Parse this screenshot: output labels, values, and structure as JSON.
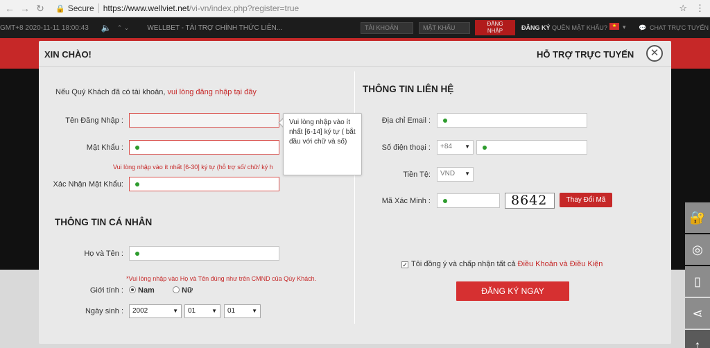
{
  "browser": {
    "secure_label": "Secure",
    "url_host": "https://www.wellviet.net",
    "url_path": "/vi-vn/index.php?register=true"
  },
  "site_header": {
    "timestamp": "GMT+8 2020-11-11 18:00:43",
    "marquee": "WELLBET - TÀI TRỢ CHÍNH THỨC LIÊN...",
    "username_placeholder": "TÀI KHOẢN",
    "password_placeholder": "MẬT KHẨU",
    "login_label_1": "ĐĂNG",
    "login_label_2": "NHẬP",
    "register_link": "ĐĂNG KÝ",
    "forgot_link": "QUÊN MẬT KHẨU?",
    "chat_link": "CHAT TRỰC TUYẾN"
  },
  "modal": {
    "title": "XIN CHÀO!",
    "support_title": "HỖ TRỢ TRỰC TUYẾN",
    "close_symbol": "✕",
    "login_prompt": "Nếu Quý Khách đã có tài khoản,",
    "login_link": "vui lòng đăng nhập tại đây",
    "username_label": "Tên Đăng Nhập :",
    "password_label": "Mật Khẩu :",
    "password_hint": "Vui lòng nhập vào ít nhất [6-30] ký tự (hỗ trợ số/ chữ/ ký h",
    "confirm_label": "Xác Nhận Mật Khẩu:",
    "tooltip": "Vui lòng nhập vào ít nhất [6-14] ký tự ( bắt đầu với chữ và số)",
    "personal_section": "THÔNG TIN CÁ NHÂN",
    "fullname_label": "Họ và Tên :",
    "fullname_hint": "*Vui lòng nhập vào Họ và Tên đúng như trên CMND của Qúy Khách.",
    "gender_label": "Giới tính :",
    "gender_male": "Nam",
    "gender_female": "Nữ",
    "birthday_label": "Ngày sinh :",
    "birth_year": "2002",
    "birth_month": "01",
    "birth_day": "01",
    "contact_section": "THÔNG TIN LIÊN HỆ",
    "email_label": "Địa chỉ Email :",
    "phone_label": "Số điện thoại :",
    "phone_code": "+84",
    "currency_label": "Tiền Tệ:",
    "currency_value": "VND",
    "captcha_label": "Mã Xác Minh :",
    "captcha_code": "8642",
    "captcha_refresh": "Thay Đổi Mã",
    "agree_text": "Tôi đồng ý và chấp nhận tất cả",
    "terms_link": "Điều Khoản và Điều Kiện",
    "submit_label": "ĐĂNG KÝ NGAY"
  }
}
